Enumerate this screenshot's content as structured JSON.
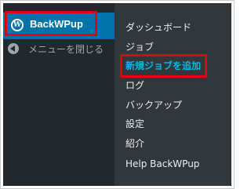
{
  "active_menu": {
    "label": "BackWPup",
    "icon": "backwpup-logo-icon"
  },
  "collapse": {
    "label": "メニューを閉じる",
    "icon": "collapse-arrow-icon"
  },
  "submenu": [
    {
      "label": "ダッシュボード"
    },
    {
      "label": "ジョブ"
    },
    {
      "label": "新規ジョブを追加",
      "current": true
    },
    {
      "label": "ログ"
    },
    {
      "label": "バックアップ"
    },
    {
      "label": "設定"
    },
    {
      "label": "紹介"
    },
    {
      "label": "Help BackWPup"
    }
  ],
  "colors": {
    "sidebar_bg": "#23282d",
    "flyout_bg": "#32373c",
    "active_bg": "#0073aa",
    "highlight_border": "#e0000f",
    "current_text": "#00b9eb"
  }
}
